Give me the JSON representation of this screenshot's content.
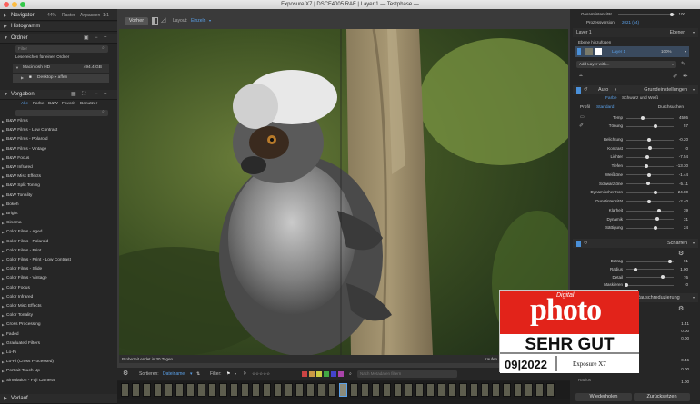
{
  "window": {
    "title": "Exposure X7 | DSCF4005.RAF | Layer 1 — Testphase —"
  },
  "navigator": {
    "title": "Navigator",
    "zoom": "44%",
    "options": [
      "Raster",
      "Anpassen",
      "1:1"
    ]
  },
  "histogram": {
    "title": "Histogramm"
  },
  "folders": {
    "title": "Ordner",
    "filter_placeholder": "Filter",
    "recent_label": "Lesezeichen für einen Ordner",
    "drive_name": "Macintosh HD",
    "drive_size": "494.4 GB",
    "path_label": "Desktop ▸ affen"
  },
  "presets": {
    "title": "Vorgaben",
    "tabs": [
      "Alle",
      "Farbe",
      "B&W",
      "Favorit",
      "Benutzer"
    ],
    "items": [
      "B&W Films",
      "B&W Films - Low Contrast",
      "B&W Films - Polaroid",
      "B&W Films - Vintage",
      "B&W Focus",
      "B&W Infrared",
      "B&W Misc Effects",
      "B&W Split Toning",
      "B&W Tonality",
      "Bokeh",
      "Bright",
      "Cinema",
      "Color Films - Aged",
      "Color Films - Polaroid",
      "Color Films - Print",
      "Color Films - Print - Low Contrast",
      "Color Films - Slide",
      "Color Films - Vintage",
      "Color Focus",
      "Color Infrared",
      "Color Misc Effects",
      "Color Tonality",
      "Cross Processing",
      "Faded",
      "Graduated Filters",
      "Lo-Fi",
      "Lo-Fi (Cross Processed)",
      "Portrait Touch Up",
      "Simulation - Fuji Camera"
    ]
  },
  "history": {
    "title": "Verlauf"
  },
  "canvas_toolbar": {
    "before_label": "Vorher",
    "layout_label": "Layout:",
    "layout_value": "Einzeln"
  },
  "canvas_status": {
    "trial": "Probezeit endet in 30 Tagen",
    "buy": "Kaufen"
  },
  "filmstrip_bar": {
    "sort_label": "Sortieren:",
    "sort_value": "Dateiname",
    "filter_label": "Filter:",
    "stars": "☆☆☆☆☆",
    "search_placeholder": "Nach Metadaten filtern",
    "thumb_count": 40
  },
  "colors": {
    "accent": "#4a90d9",
    "accent_text": "#5aa0e8",
    "label_colors": [
      "#c44",
      "#c94",
      "#cc4",
      "#4a4",
      "#44c",
      "#a4a"
    ]
  },
  "right": {
    "overall_label": "Gesamtintensität",
    "overall_value": "100",
    "process_label": "Prozessversion",
    "process_value": "2021 (v4)",
    "layer_label": "Layer 1",
    "layers_title": "Ebenen",
    "add_layer_label": "Ebene hinzufügen",
    "layer_name": "Layer 1",
    "layer_opacity": "100%",
    "add_layer_with": "Add Layer with...",
    "basic": {
      "auto_label": "Auto",
      "title": "Grundeinstellungen",
      "modes": [
        "Farbe",
        "Schwarz und Weiß"
      ],
      "profile_label": "Profil",
      "profile_value": "Standard",
      "profile_extra": "Durchsuchen",
      "temp": {
        "label": "Temp",
        "value": "4586",
        "pos": 0.35
      },
      "tint": {
        "label": "Tönung",
        "value": "57",
        "pos": 0.62
      },
      "tonal": [
        {
          "label": "Belichtung",
          "value": "-0.20",
          "pos": 0.48
        },
        {
          "label": "Kontrast",
          "value": "0",
          "pos": 0.5
        },
        {
          "label": "Lichter",
          "value": "-7.54",
          "pos": 0.45
        },
        {
          "label": "Tiefen",
          "value": "-13.30",
          "pos": 0.42
        },
        {
          "label": "Weißtöne",
          "value": "-1.44",
          "pos": 0.48
        },
        {
          "label": "Schwarztöne",
          "value": "-5.11",
          "pos": 0.46
        },
        {
          "label": "Dynamischer Kon",
          "value": "24.80",
          "pos": 0.62
        },
        {
          "label": "Dunstintensität",
          "value": "-2.40",
          "pos": 0.48
        }
      ],
      "presence": [
        {
          "label": "Klarheit",
          "value": "39",
          "pos": 0.7
        },
        {
          "label": "Dynamik",
          "value": "31",
          "pos": 0.66
        },
        {
          "label": "Sättigung",
          "value": "24",
          "pos": 0.62
        }
      ]
    },
    "sharpen": {
      "title": "Schärfen",
      "rows": [
        {
          "label": "Betrag",
          "value": "91",
          "pos": 0.92
        },
        {
          "label": "Radius",
          "value": "1.00",
          "pos": 0.2
        },
        {
          "label": "Detail",
          "value": "76",
          "pos": 0.76
        },
        {
          "label": "Maskieren",
          "value": "0",
          "pos": 0.0
        }
      ]
    },
    "noise": {
      "title": "Rauschreduzierung",
      "values": [
        "1.41",
        "0.00",
        "0.00",
        "0.46",
        "0.00",
        "1.00"
      ],
      "last_label": "Radius"
    },
    "reset_label": "Wiederholen",
    "reset_all_label": "Zurücksetzen"
  },
  "badge": {
    "brand_small": "Digital",
    "brand": "photo",
    "rating": "SEHR GUT",
    "issue": "09|2022",
    "product": "Exposure X7"
  }
}
